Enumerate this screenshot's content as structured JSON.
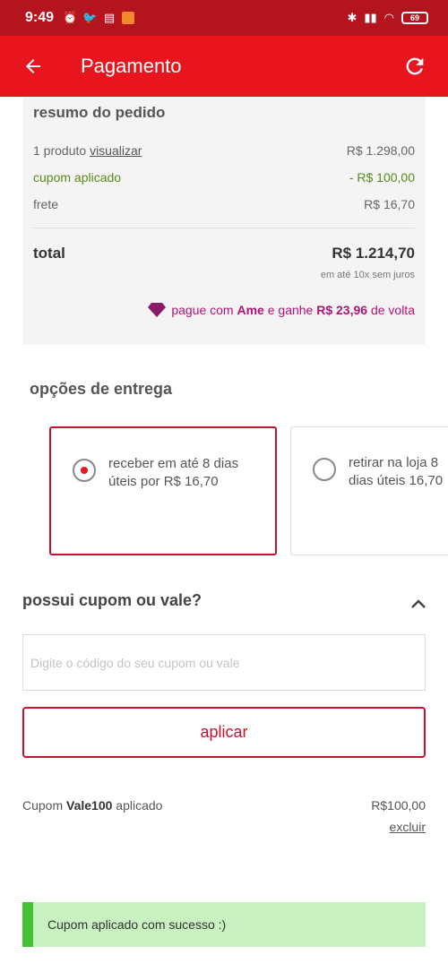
{
  "status_bar": {
    "time": "9:49",
    "battery": "69"
  },
  "app_bar": {
    "title": "Pagamento"
  },
  "summary": {
    "heading": "resumo do pedido",
    "product_label": "1 produto",
    "product_link": "visualizar",
    "product_price": "R$ 1.298,00",
    "coupon_label": "cupom aplicado",
    "coupon_value": "- R$ 100,00",
    "shipping_label": "frete",
    "shipping_value": "R$ 16,70",
    "total_label": "total",
    "total_value": "R$ 1.214,70",
    "installments": "em até 10x sem juros",
    "ame_prefix": "pague com ",
    "ame_brand": "Ame",
    "ame_middle": " e ganhe ",
    "ame_amount": "R$ 23,96",
    "ame_suffix": " de volta"
  },
  "delivery": {
    "title": "opções de entrega",
    "options": [
      {
        "text": "receber em até 8 dias úteis por R$ 16,70",
        "selected": true
      },
      {
        "text": "retirar na loja 8 dias úteis 16,70",
        "selected": false
      }
    ]
  },
  "coupon": {
    "title": "possui cupom ou vale?",
    "placeholder": "Digite o código do seu cupom ou vale",
    "apply_label": "aplicar",
    "applied_prefix": "Cupom ",
    "applied_code": "Vale100",
    "applied_suffix": " aplicado",
    "applied_value": "R$100,00",
    "remove_label": "excluir"
  },
  "toast": {
    "message": "Cupom aplicado com sucesso :)"
  },
  "colors": {
    "primary": "#e8141e",
    "dark": "#b3141e",
    "success": "#43c232",
    "ame": "#b0127a"
  }
}
